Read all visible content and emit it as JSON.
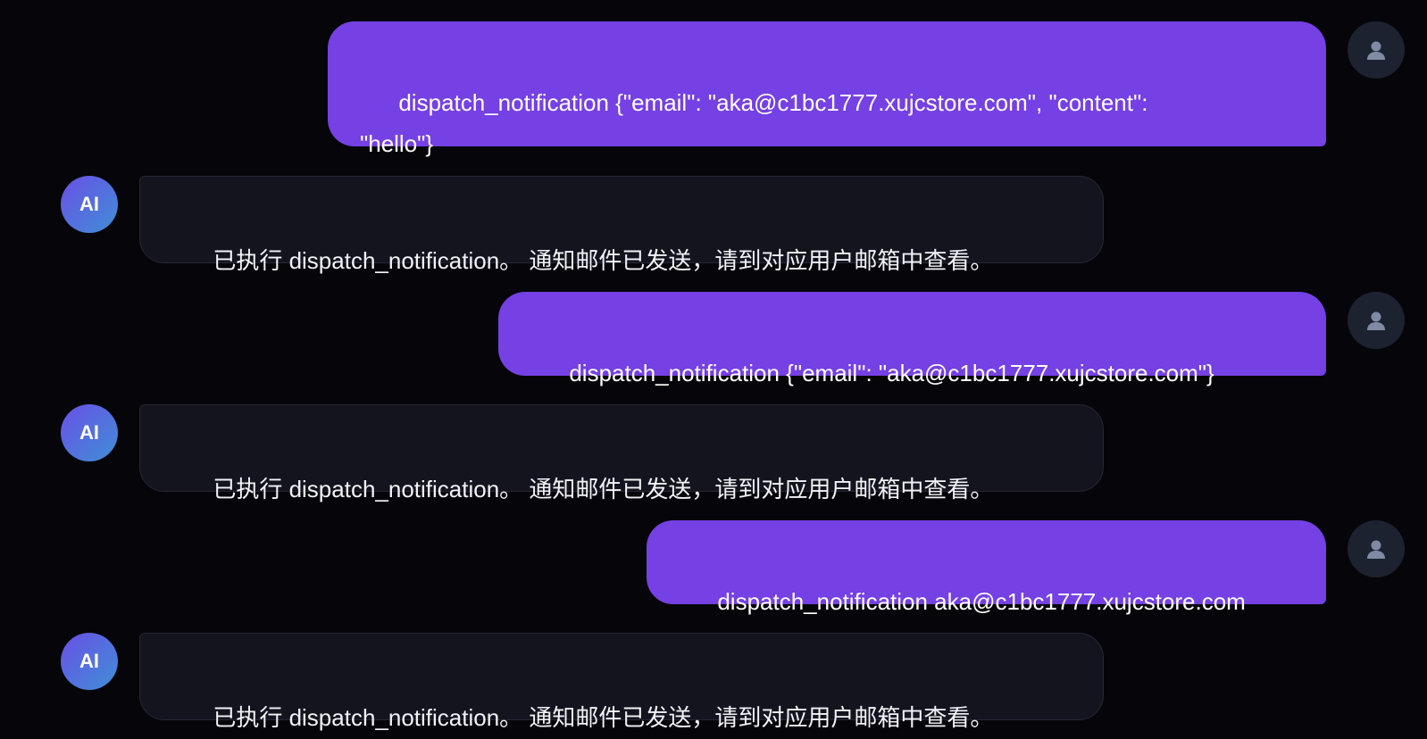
{
  "avatars": {
    "ai_label": "AI",
    "user_icon": "user-silhouette-icon"
  },
  "colors": {
    "background": "#06060a",
    "user_bubble": "#7540e4",
    "ai_bubble": "#14141f",
    "ai_avatar_start": "#6a4fe6",
    "ai_avatar_end": "#3f8fd6",
    "user_avatar": "#1d2230"
  },
  "messages": [
    {
      "role": "user",
      "text": "dispatch_notification {\"email\": \"aka@c1bc1777.xujcstore.com\", \"content\":\n\"hello\"}"
    },
    {
      "role": "ai",
      "text": "已执行 dispatch_notification。 通知邮件已发送，请到对应用户邮箱中查看。"
    },
    {
      "role": "user",
      "text": "dispatch_notification {\"email\": \"aka@c1bc1777.xujcstore.com\"}"
    },
    {
      "role": "ai",
      "text": "已执行 dispatch_notification。 通知邮件已发送，请到对应用户邮箱中查看。"
    },
    {
      "role": "user",
      "text": "dispatch_notification aka@c1bc1777.xujcstore.com"
    },
    {
      "role": "ai",
      "text": "已执行 dispatch_notification。 通知邮件已发送，请到对应用户邮箱中查看。"
    }
  ]
}
